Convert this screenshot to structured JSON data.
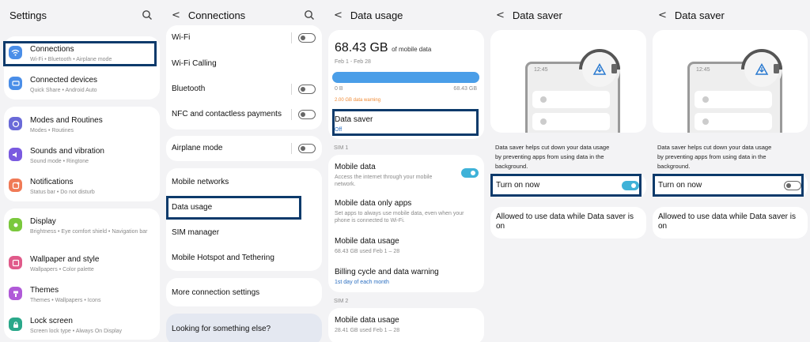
{
  "colors": {
    "accent": "#3fb2d8",
    "highlight": "#0c3a6b",
    "warning": "#f08a34"
  },
  "settings": {
    "title": "Settings",
    "items": [
      {
        "label": "Connections",
        "sub": "Wi-Fi • Bluetooth • Airplane mode",
        "icon": "wifi-icon",
        "color": "#4a8ee8"
      },
      {
        "label": "Connected devices",
        "sub": "Quick Share • Android Auto",
        "icon": "devices-icon",
        "color": "#4a8ee8"
      },
      {
        "label": "Modes and Routines",
        "sub": "Modes • Routines",
        "icon": "modes-icon",
        "color": "#6a6ad8"
      },
      {
        "label": "Sounds and vibration",
        "sub": "Sound mode • Ringtone",
        "icon": "sound-icon",
        "color": "#7a5ae0"
      },
      {
        "label": "Notifications",
        "sub": "Status bar • Do not disturb",
        "icon": "notifications-icon",
        "color": "#f07a56"
      },
      {
        "label": "Display",
        "sub": "Brightness • Eye comfort shield • Navigation bar",
        "icon": "display-icon",
        "color": "#7ac83c"
      },
      {
        "label": "Wallpaper and style",
        "sub": "Wallpapers • Color palette",
        "icon": "wallpaper-icon",
        "color": "#e05a8a"
      },
      {
        "label": "Themes",
        "sub": "Themes • Wallpapers • Icons",
        "icon": "themes-icon",
        "color": "#b05ad8"
      },
      {
        "label": "Lock screen",
        "sub": "Screen lock type • Always On Display",
        "icon": "lock-icon",
        "color": "#2aa88a"
      }
    ]
  },
  "connections": {
    "title": "Connections",
    "items": [
      "Wi-Fi",
      "Wi-Fi Calling",
      "Bluetooth",
      "NFC and contactless payments",
      "Airplane mode",
      "Mobile networks",
      "Data usage",
      "SIM manager",
      "Mobile Hotspot and Tethering",
      "More connection settings",
      "Looking for something else?"
    ]
  },
  "data_usage": {
    "title": "Data usage",
    "amount": "68.43 GB",
    "amount_suffix": "of mobile data",
    "period": "Feb 1 - Feb 28",
    "bar_min": "0 B",
    "bar_max": "68.43 GB",
    "bar_fill": 1.0,
    "warning": "2.00 GB data warning",
    "data_saver_label": "Data saver",
    "data_saver_value": "Off",
    "sim1": "SIM 1",
    "sim2": "SIM 2",
    "mobile_data": "Mobile data",
    "mobile_data_sub": "Access the internet through your mobile network.",
    "only_apps": "Mobile data only apps",
    "only_apps_sub": "Set apps to always use mobile data, even when your phone is connected to Wi-Fi.",
    "usage1": "Mobile data usage",
    "usage1_sub": "68.43 GB used Feb 1 – 28",
    "billing": "Billing cycle and data warning",
    "billing_sub": "1st day of each month",
    "usage2": "Mobile data usage",
    "usage2_sub": "28.41 GB used Feb 1 – 28"
  },
  "saver_a": {
    "title": "Data saver",
    "time": "12:45",
    "desc": "Data saver helps cut down your data usage by preventing apps from using data in the background.",
    "toggle_label": "Turn on now",
    "toggle_on": true,
    "allowed": "Allowed to use data while Data saver is on"
  },
  "saver_b": {
    "title": "Data saver",
    "time": "12:45",
    "desc": "Data saver helps cut down your data usage by preventing apps from using data in the background.",
    "toggle_label": "Turn on now",
    "toggle_on": false,
    "allowed": "Allowed to use data while Data saver is on"
  }
}
